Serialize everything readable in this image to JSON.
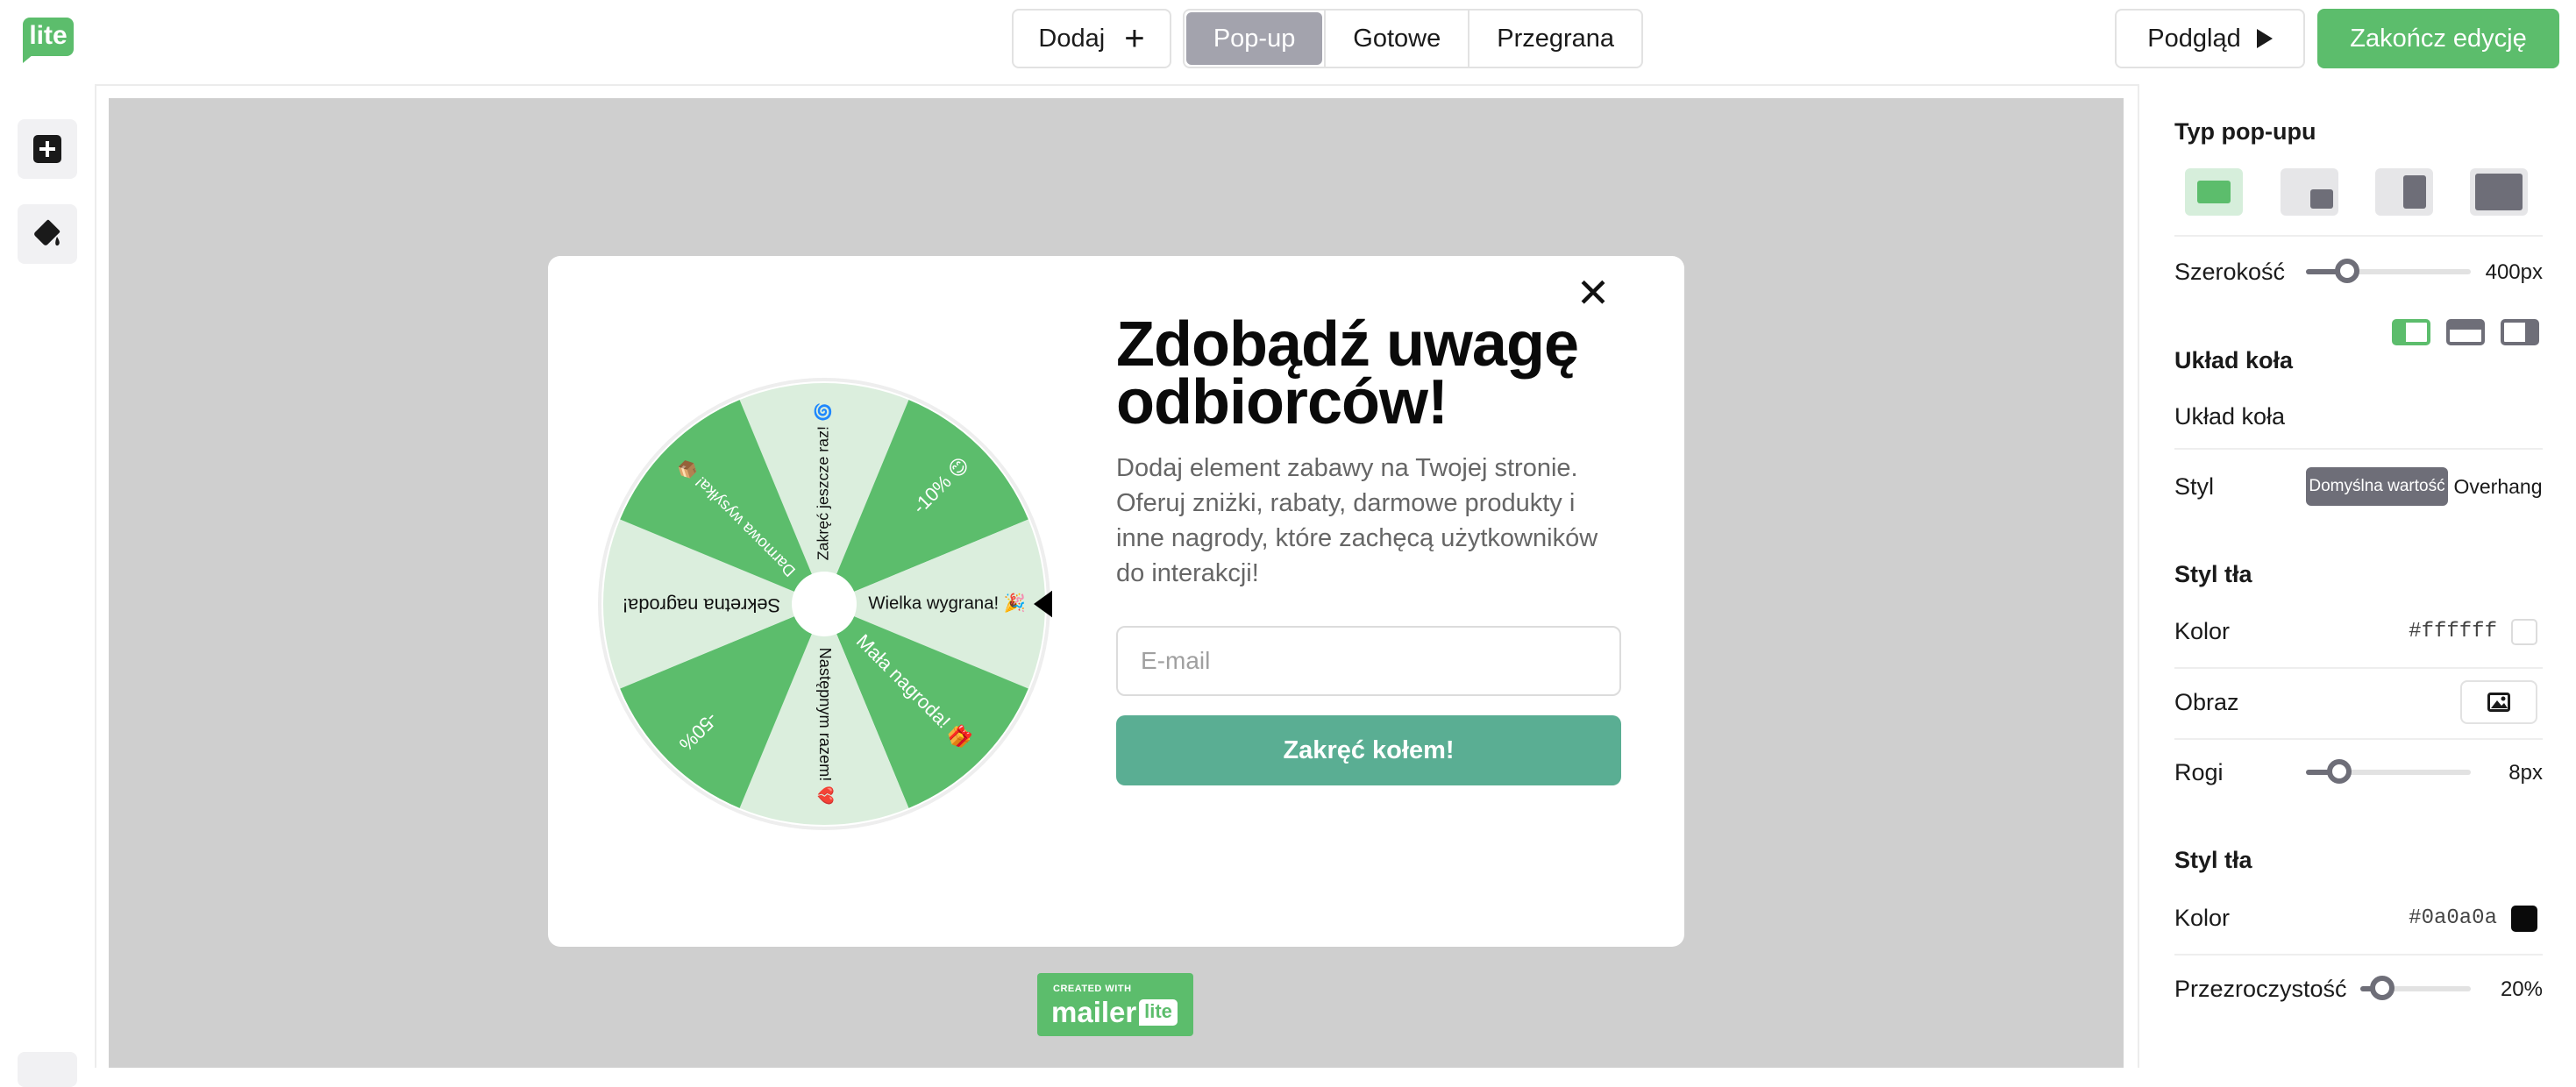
{
  "app": {
    "logo_text": "lite"
  },
  "toolbar": {
    "add_label": "Dodaj",
    "tabs": [
      {
        "label": "Pop-up",
        "active": true
      },
      {
        "label": "Gotowe",
        "active": false
      },
      {
        "label": "Przegrana",
        "active": false
      }
    ],
    "preview_label": "Podgląd",
    "finish_label": "Zakończ edycję",
    "accent_color": "#5cbd6c"
  },
  "popup": {
    "headline_line1": "Zdobądź uwagę",
    "headline_line2": "odbiorców!",
    "description": "Dodaj element zabawy na Twojej stronie. Oferuj zniżki, rabaty, darmowe produkty i inne nagrody, które zachęcą użytkowników do interakcji!",
    "email_placeholder": "E-mail",
    "spin_button_label": "Zakręć kołem!",
    "close_label": "✕",
    "wheel": {
      "segments": [
        {
          "label": "Zakręć jeszcze raz! 🌀",
          "shade": "light"
        },
        {
          "label": "-10% 😊",
          "shade": "dark"
        },
        {
          "label": "Wielka wygrana! 🎉",
          "shade": "light"
        },
        {
          "label": "Mała nagroda! 🎁",
          "shade": "dark"
        },
        {
          "label": "Następnym razem! 💔",
          "shade": "light"
        },
        {
          "label": "-50%",
          "shade": "dark"
        },
        {
          "label": "Sekretna nagroda!",
          "shade": "light"
        },
        {
          "label": "Darmowa wysyłka! 📦",
          "shade": "dark"
        }
      ],
      "dark_color": "#5cbd6c",
      "light_color": "#dbeedd"
    }
  },
  "badge": {
    "created_with": "CREATED WITH",
    "brand": "mailer",
    "lite": "lite"
  },
  "settings": {
    "popup_type": {
      "label": "Typ pop-upu",
      "selected_index": 0
    },
    "width": {
      "label": "Szerokość",
      "value": "400px",
      "level": 0.25
    },
    "wheel_layout_heading": "Układ koła",
    "wheel_layout_label": "Układ koła",
    "style_label": "Styl",
    "style_options": [
      "Domyślna wartość",
      "Overhang"
    ],
    "style_selected": "Domyślna wartość",
    "background": {
      "heading": "Styl tła",
      "color_label": "Kolor",
      "color_value": "#ffffff",
      "image_label": "Obraz",
      "corners_label": "Rogi",
      "corners_value": "8px",
      "corners_level": 0.2
    },
    "overlay": {
      "heading": "Styl tła",
      "color_label": "Kolor",
      "color_value": "#0a0a0a",
      "opacity_label": "Przezroczystość",
      "opacity_value": "20%",
      "opacity_level": 0.2
    }
  }
}
